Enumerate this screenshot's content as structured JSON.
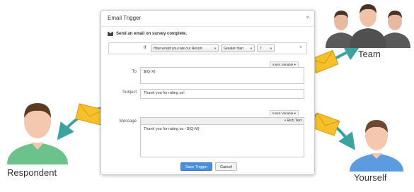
{
  "dialog": {
    "title": "Email Trigger",
    "close": "×",
    "send_label": "Send an email on survey complete."
  },
  "condition": {
    "if_label": "If",
    "question": "How would you rate our Resort",
    "operator": "Greater than",
    "value": "7",
    "remove": "×"
  },
  "to": {
    "insert_variable": "Insert Variable",
    "label": "To",
    "value": "${Q-X}"
  },
  "subject": {
    "label": "Subject",
    "value": "Thank you for rating us!"
  },
  "message": {
    "insert_variable": "Insert Variable",
    "label": "Message",
    "rich_text": "» Rich Text",
    "value": "Thank you for rating us - ${Q-M}"
  },
  "buttons": {
    "save": "Save Trigger",
    "cancel": "Cancel"
  },
  "recipients": {
    "team": "Team",
    "respondent": "Respondent",
    "yourself": "Yourself"
  },
  "colors": {
    "arrow": "#3aa3a0",
    "envelope": "#f6c02a",
    "primary_button": "#4a8fd9",
    "team_shirt": "#5a5a5a",
    "respondent_shirt": "#6cc28b",
    "yourself_shirt": "#5b9be0"
  },
  "icons": [
    "email-icon",
    "close-icon",
    "chevron-down-icon",
    "envelope-icon",
    "arrow-icon",
    "person-icon"
  ]
}
